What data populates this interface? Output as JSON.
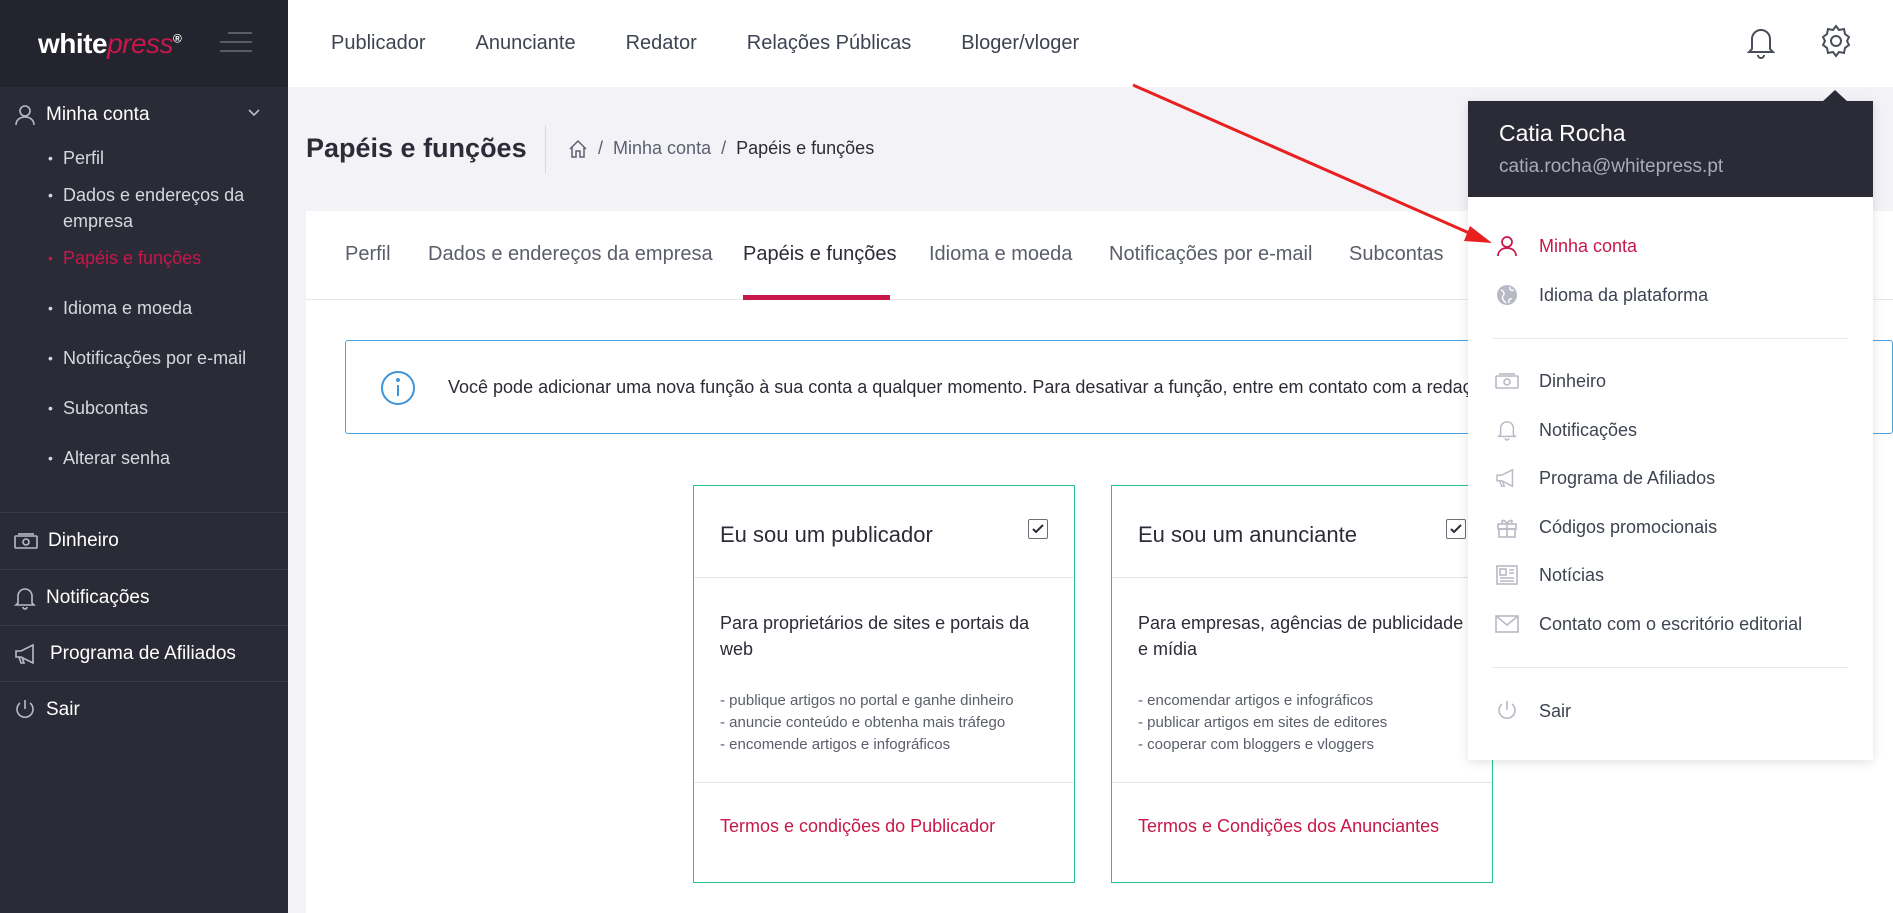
{
  "brand": {
    "logo_white": "white",
    "logo_red": "press",
    "logo_reg": "®",
    "accent": "#c8174a"
  },
  "sidebar": {
    "account": {
      "label": "Minha conta",
      "items": [
        {
          "label": "Perfil"
        },
        {
          "label": "Dados e endereços da empresa"
        },
        {
          "label": "Papéis e funções"
        },
        {
          "label": "Idioma e moeda"
        },
        {
          "label": "Notificações por e-mail"
        },
        {
          "label": "Subcontas"
        },
        {
          "label": "Alterar senha"
        }
      ]
    },
    "sections": [
      {
        "label": "Dinheiro"
      },
      {
        "label": "Notificações"
      },
      {
        "label": "Programa de Afiliados"
      },
      {
        "label": "Sair"
      }
    ]
  },
  "topnav": {
    "items": [
      {
        "label": "Publicador"
      },
      {
        "label": "Anunciante"
      },
      {
        "label": "Redator"
      },
      {
        "label": "Relações Públicas"
      },
      {
        "label": "Bloger/vloger"
      }
    ]
  },
  "page": {
    "title": "Papéis e funções",
    "breadcrumb": [
      "Minha conta",
      "Papéis e funções"
    ],
    "separator": "/"
  },
  "tabs": [
    {
      "label": "Perfil"
    },
    {
      "label": "Dados e endereços da empresa"
    },
    {
      "label": "Papéis e funções",
      "active": true
    },
    {
      "label": "Idioma e moeda"
    },
    {
      "label": "Notificações por e-mail"
    },
    {
      "label": "Subcontas"
    }
  ],
  "info": {
    "text": "Você pode adicionar uma nova função à sua conta a qualquer momento. Para desativar a função, entre em contato com a redaç"
  },
  "roles": [
    {
      "title": "Eu sou um publicador",
      "checked": true,
      "description": "Para proprietários de sites e portais da web",
      "bullets": [
        "- publique artigos no portal e ganhe dinheiro",
        "- anuncie conteúdo e obtenha mais tráfego",
        "- encomende artigos e infográficos"
      ],
      "link": "Termos e condições do Publicador"
    },
    {
      "title": "Eu sou um anunciante",
      "checked": true,
      "description": "Para empresas, agências de publicidade e mídia",
      "bullets": [
        "- encomendar artigos e infográficos",
        "- publicar artigos em sites de editores",
        "- cooperar com bloggers e vloggers"
      ],
      "link": "Termos e Condições dos Anunciantes"
    }
  ],
  "user_menu": {
    "name": "Catia Rocha",
    "email": "catia.rocha@whitepress.pt",
    "items": [
      {
        "label": "Minha conta",
        "icon": "user-icon",
        "active": true
      },
      {
        "label": "Idioma da plataforma",
        "icon": "globe-icon"
      },
      {
        "label": "Dinheiro",
        "icon": "money-icon"
      },
      {
        "label": "Notificações",
        "icon": "bell-icon"
      },
      {
        "label": "Programa de Afiliados",
        "icon": "megaphone-icon"
      },
      {
        "label": "Códigos promocionais",
        "icon": "gift-icon"
      },
      {
        "label": "Notícias",
        "icon": "news-icon"
      },
      {
        "label": "Contato com o escritório editorial",
        "icon": "mail-icon"
      },
      {
        "label": "Sair",
        "icon": "power-icon"
      }
    ]
  }
}
